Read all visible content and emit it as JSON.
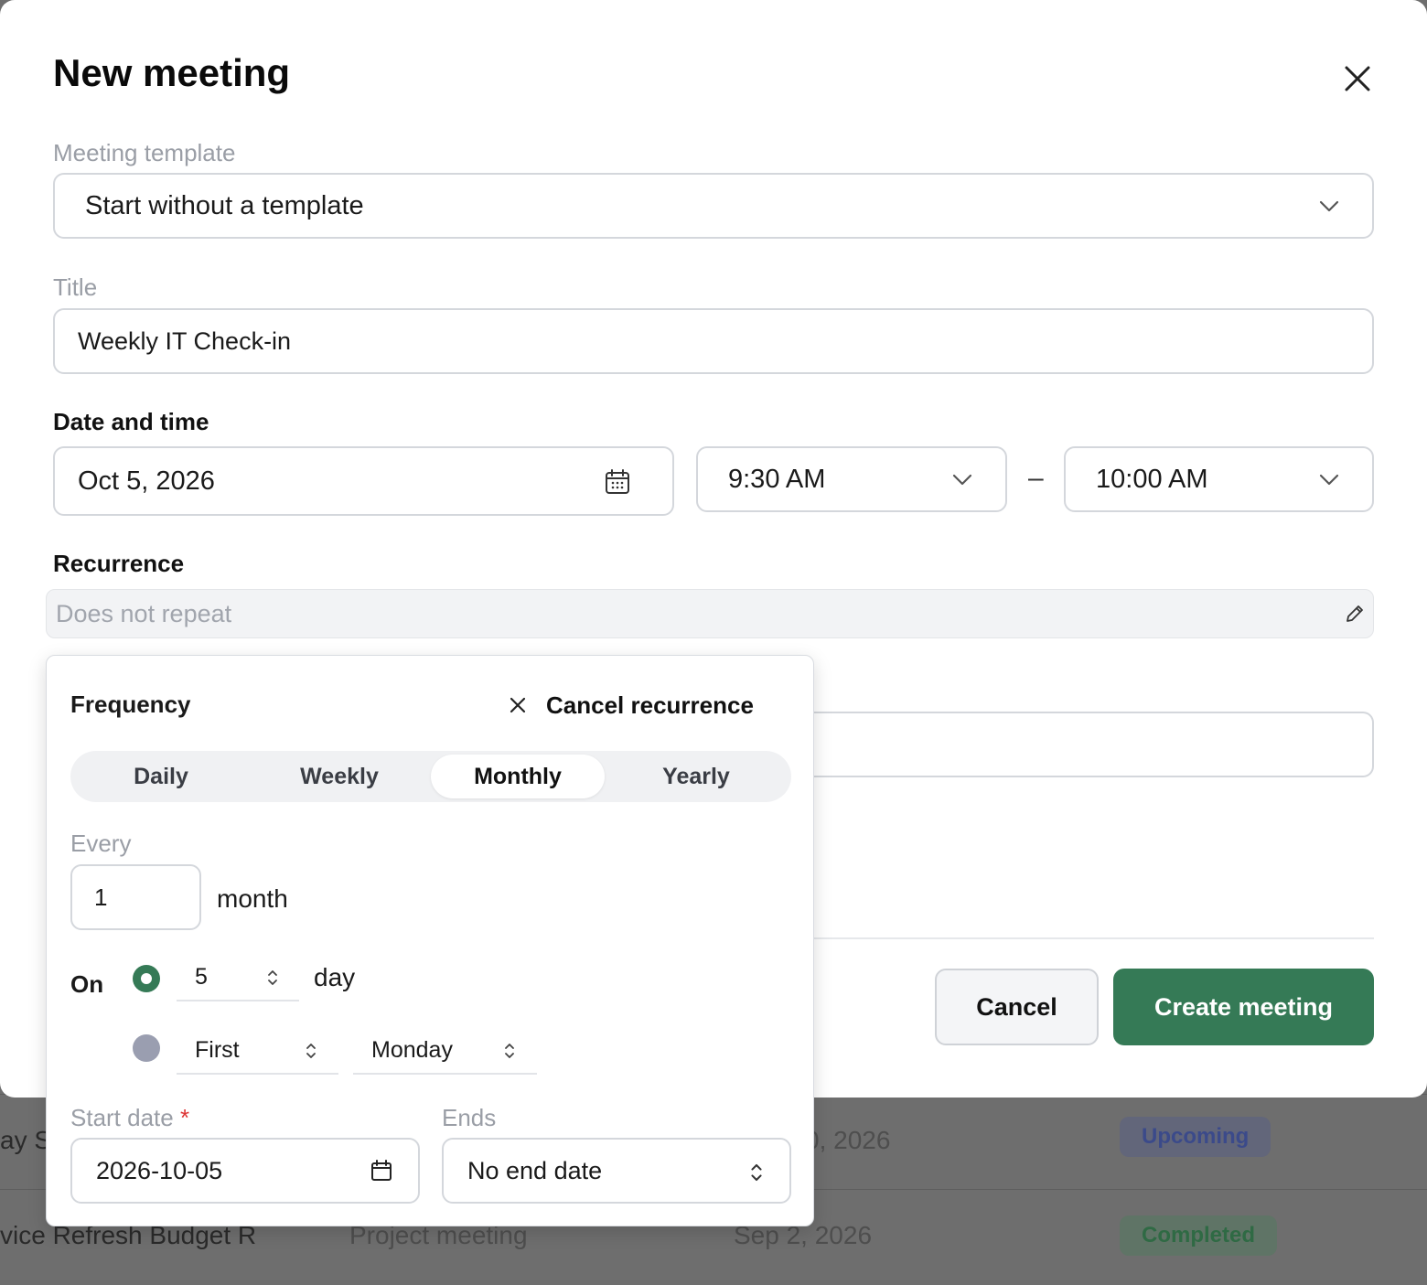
{
  "background_list": {
    "rows": [
      {
        "title": "ay S",
        "date": "0, 2026",
        "status": "Upcoming"
      },
      {
        "title": "vice Refresh Budget R",
        "type": "Project meeting",
        "date": "Sep 2, 2026",
        "status": "Completed"
      }
    ]
  },
  "modal": {
    "title": "New meeting",
    "close_icon": "close-icon",
    "template": {
      "label": "Meeting template",
      "value": "Start without a template"
    },
    "title_field": {
      "label": "Title",
      "value": "Weekly IT Check-in"
    },
    "date_time": {
      "label": "Date and time",
      "date": "Oct 5, 2026",
      "start_time": "9:30 AM",
      "separator": "–",
      "end_time": "10:00 AM"
    },
    "recurrence": {
      "label": "Recurrence",
      "placeholder": "Does not repeat",
      "edit_icon": "pencil-icon"
    },
    "buttons": {
      "cancel": "Cancel",
      "create": "Create meeting"
    },
    "accent_color": "#357a56"
  },
  "recurrence_popover": {
    "title": "Frequency",
    "cancel_recurrence": "Cancel recurrence",
    "frequencies": [
      "Daily",
      "Weekly",
      "Monthly",
      "Yearly"
    ],
    "selected_frequency": "Monthly",
    "every": {
      "label": "Every",
      "value": "1",
      "unit": "month"
    },
    "on": {
      "label": "On",
      "day_option": {
        "selected": true,
        "value": "5",
        "suffix": "day"
      },
      "weekday_option": {
        "selected": false,
        "ordinal": "First",
        "weekday": "Monday"
      }
    },
    "start_date": {
      "label": "Start date",
      "required_mark": "*",
      "value": "2026-10-05"
    },
    "ends": {
      "label": "Ends",
      "value": "No end date"
    }
  }
}
